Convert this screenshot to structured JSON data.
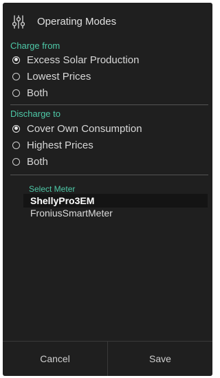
{
  "header": {
    "icon": "sliders-icon",
    "title": "Operating Modes"
  },
  "charge": {
    "label": "Charge from",
    "options": [
      {
        "label": "Excess Solar Production",
        "checked": true
      },
      {
        "label": "Lowest Prices",
        "checked": false
      },
      {
        "label": "Both",
        "checked": false
      }
    ]
  },
  "discharge": {
    "label": "Discharge to",
    "options": [
      {
        "label": "Cover Own Consumption",
        "checked": true
      },
      {
        "label": "Highest Prices",
        "checked": false
      },
      {
        "label": "Both",
        "checked": false
      }
    ]
  },
  "meter": {
    "label": "Select Meter",
    "items": [
      {
        "label": "ShellyPro3EM",
        "selected": true
      },
      {
        "label": "FroniusSmartMeter",
        "selected": false
      }
    ]
  },
  "footer": {
    "cancel_label": "Cancel",
    "save_label": "Save"
  },
  "colors": {
    "background": "#1f1f1f",
    "accent": "#4ec9a8",
    "text": "#d8d8d8"
  }
}
